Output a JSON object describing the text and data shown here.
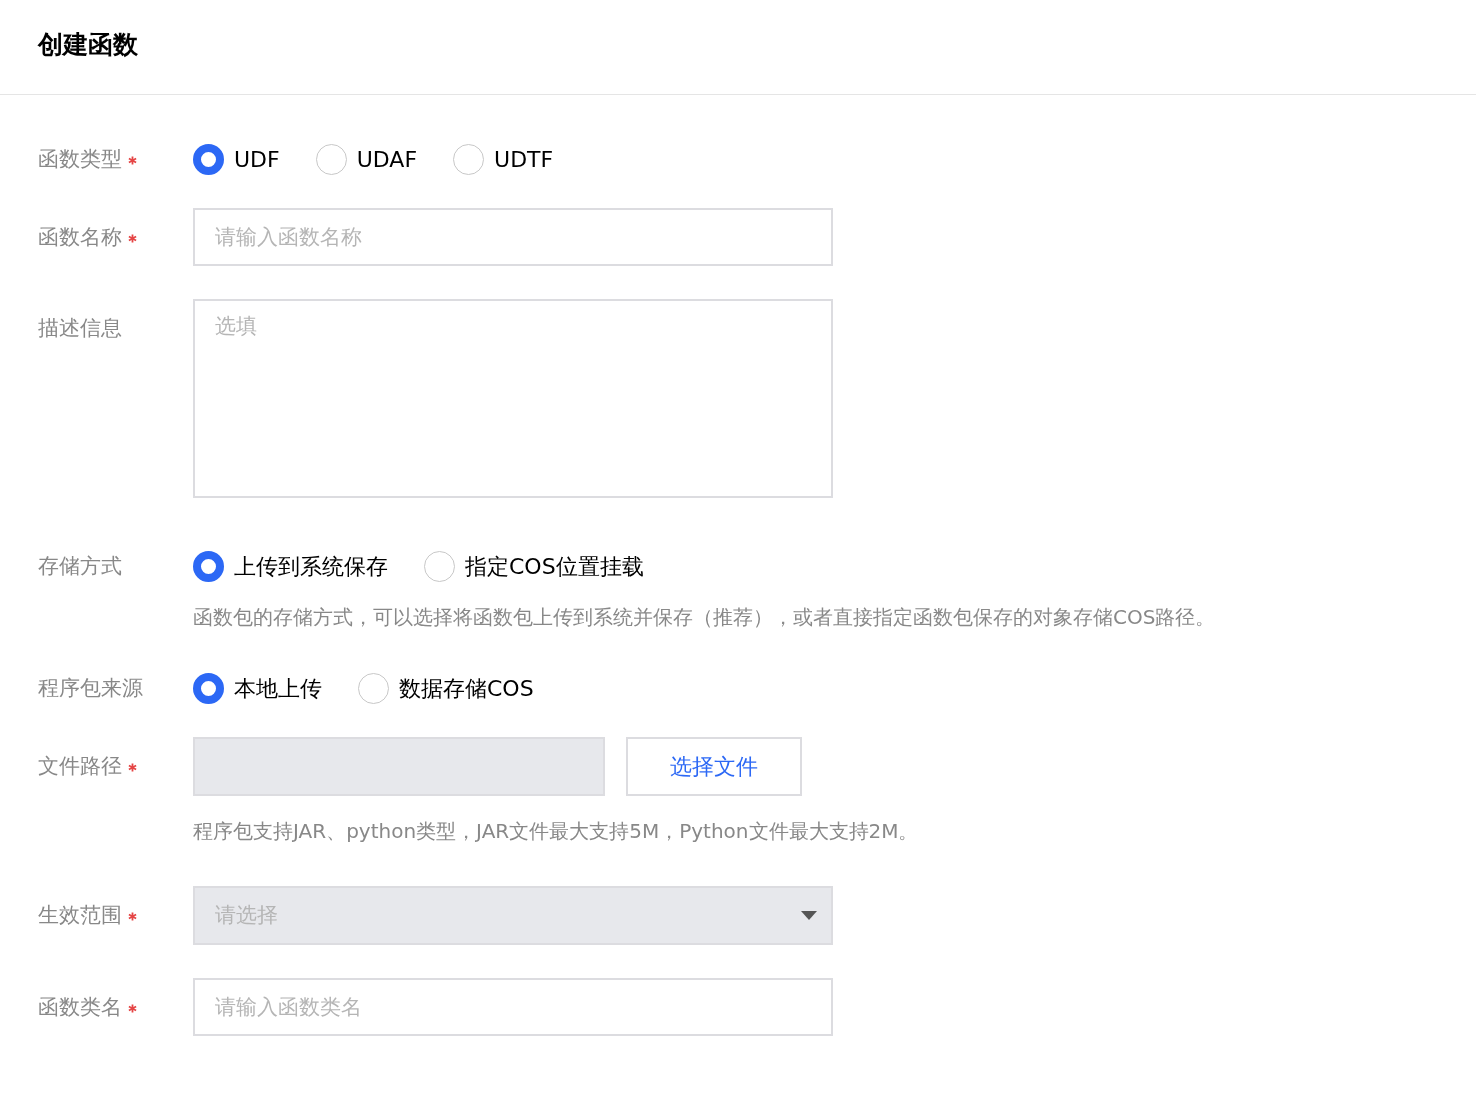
{
  "title": "创建函数",
  "fields": [
    {
      "kind": "radio",
      "label": "函数类型",
      "required": true,
      "options": [
        {
          "label": "UDF",
          "selected": true
        },
        {
          "label": "UDAF",
          "selected": false
        },
        {
          "label": "UDTF",
          "selected": false
        }
      ]
    },
    {
      "kind": "input",
      "label": "函数名称",
      "required": true,
      "placeholder": "请输入函数名称"
    },
    {
      "kind": "textarea",
      "label": "描述信息",
      "required": false,
      "placeholder": "选填"
    },
    {
      "kind": "radio",
      "label": "存储方式",
      "required": false,
      "options": [
        {
          "label": "上传到系统保存",
          "selected": true
        },
        {
          "label": "指定COS位置挂载",
          "selected": false
        }
      ],
      "help": "函数包的存储方式，可以选择将函数包上传到系统并保存（推荐），或者直接指定函数包保存的对象存储COS路径。"
    },
    {
      "kind": "radio",
      "label": "程序包来源",
      "required": false,
      "options": [
        {
          "label": "本地上传",
          "selected": true
        },
        {
          "label": "数据存储COS",
          "selected": false
        }
      ]
    },
    {
      "kind": "file",
      "label": "文件路径",
      "required": true,
      "disabled": true,
      "button": "选择文件",
      "help": "程序包支持JAR、python类型，JAR文件最大支持5M，Python文件最大支持2M。"
    },
    {
      "kind": "select",
      "label": "生效范围",
      "required": true,
      "disabled": true,
      "placeholder": "请选择"
    },
    {
      "kind": "input",
      "label": "函数类名",
      "required": true,
      "placeholder": "请输入函数类名"
    }
  ]
}
